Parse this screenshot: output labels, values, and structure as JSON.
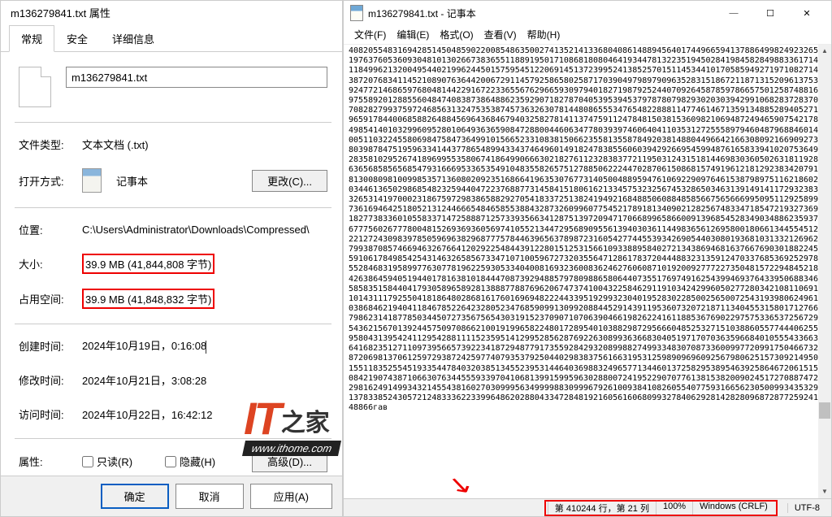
{
  "props": {
    "title": "m136279841.txt 属性",
    "tabs": {
      "general": "常规",
      "security": "安全",
      "details": "详细信息"
    },
    "filename": "m136279841.txt",
    "labels": {
      "filetype": "文件类型:",
      "openwith": "打开方式:",
      "location": "位置:",
      "size": "大小:",
      "sizeondisk": "占用空间:",
      "created": "创建时间:",
      "modified": "修改时间:",
      "accessed": "访问时间:",
      "attributes": "属性:"
    },
    "values": {
      "filetype": "文本文档 (.txt)",
      "openwith": "记事本",
      "change": "更改(C)...",
      "location": "C:\\Users\\Administrator\\Downloads\\Compressed\\",
      "size": "39.9 MB (41,844,808 字节)",
      "sizeondisk": "39.9 MB (41,848,832 字节)",
      "created": "2024年10月19日，0:16:08",
      "modified": "2024年10月21日，3:08:28",
      "accessed": "2024年10月22日，16:42:12",
      "readonly": "只读(R)",
      "hidden": "隐藏(H)",
      "advanced": "高级(D)..."
    },
    "buttons": {
      "ok": "确定",
      "cancel": "取消",
      "apply": "应用(A)"
    }
  },
  "notepad": {
    "title": "m136279841.txt - 记事本",
    "menu": {
      "file": "文件(F)",
      "edit": "编辑(E)",
      "format": "格式(O)",
      "view": "查看(V)",
      "help": "帮助(H)"
    },
    "content": "40820554831694285145048590220085486350027413521413368040861488945640174496659413788649982492326551976376053609304810130266738365511889195017108681808046419344781322351945028419845828498833617143118499621320049544021996244501575954512206914513723995241385257015114534410170585949271971082714638720768341145210890763644200672911457925865802587170390497989790963528315186721187131520961375319247721468659768048144229167223365567629665930979401827198792524407092645878597866575012587488167975589201288556048474083873864886235929071827870405395394537978780798293020303942991068283728370670828279937597246856313247535387457363263078144808655534765482288811477461467135913488528940527119659178440068588264884569643684679403258278141137475911247848150381536098210694872494659075421789498541401032996095280106493636590847288004460634778039397460640411035312725558979460487968846014900511032245580698475847364991015665233108381506623558135587849203814880449664216630809216690927378039878475195963341443778654899433437464960149182478385560603942926695459948761658339410207536492283581029526741896995535806741864990666302182761123283837721195031243151814469830360502631811928363656858565685479316669533653549104835582657512788506222447028706150868157491961218129238342079148130080981009985357136080209235168664196353076773140500488959476106922909764615387989751162186029034461365029868548232594404722376887731458415180616213345753232567453286503463139149141172932383432653141970002318675972983865882927054183372513824194921684885060884858566756566699509511292589947361694642518052131244666548465855388432873260996077545217891813409021282567483347185472193273691182773833601055833714725888712573393566341287513972094717066899658660091396854528349034886235937367775602677780048152693693605697410552134472956890955613940303611449836561269580018066134455451212212724309839785059696382968777578446396563789872316054277445539342690544030801936810313321269629799387085746694632676641202922548443912280151253156610933889584027213438694681637667690301882245659106178498542543146326585673347107100596727320355647128617837204448832313591247033768536925297855528468319589977630778196225930533404008169323600836246276060871019200927772273504815722948452181426386459405194401781638101844470873929488579780988658064407355176974916254399469376433950688346858583515844041793058965892813888778876962067473741004322584629119103424299605027728034210811069161014311179255041818648028681617601696948222443395192993230401952830228500256500725431939806249617038684621940411846785226423280523476859099130992088445291439119536073207218711340455315801712766679862314187785034450727356756543031915237090710706390466198262241611885367690229757533653725672995436215670139244575097086621001919965822480172895401038829872956660485253271510388605577444062552958043139542411295428811115235951412995285628769226308993636683040519717070363596684010555433663164168235127110973956657392234187294877917355928429320899882749933483070873360099772099175046673258720698137061259729387242597740793537925044029838375616631953125989096960925679806251573092149508155118352554519335447840320385134552395314464036988324965771344601372582953895463925864672061515408421907438710663076344555933970410681399159959630288007241952290707761381538200902451727088747272981624914993432145543816027030999563499998830999679261009384108260554077593166562305009934353290137833852430572124833362233996486202880433472848192160561606809932784062928142828096872877259241648866гав",
    "win": {
      "min": "—",
      "max": "☐",
      "close": "✕"
    },
    "status": {
      "pos": "第 410244 行，第 21 列",
      "zoom": "100%",
      "eol": "Windows (CRLF)",
      "enc": "UTF-8"
    }
  },
  "watermark": {
    "it": "IT",
    "zh": "之家",
    "url": "www.ithome.com"
  },
  "arrow": "↘"
}
